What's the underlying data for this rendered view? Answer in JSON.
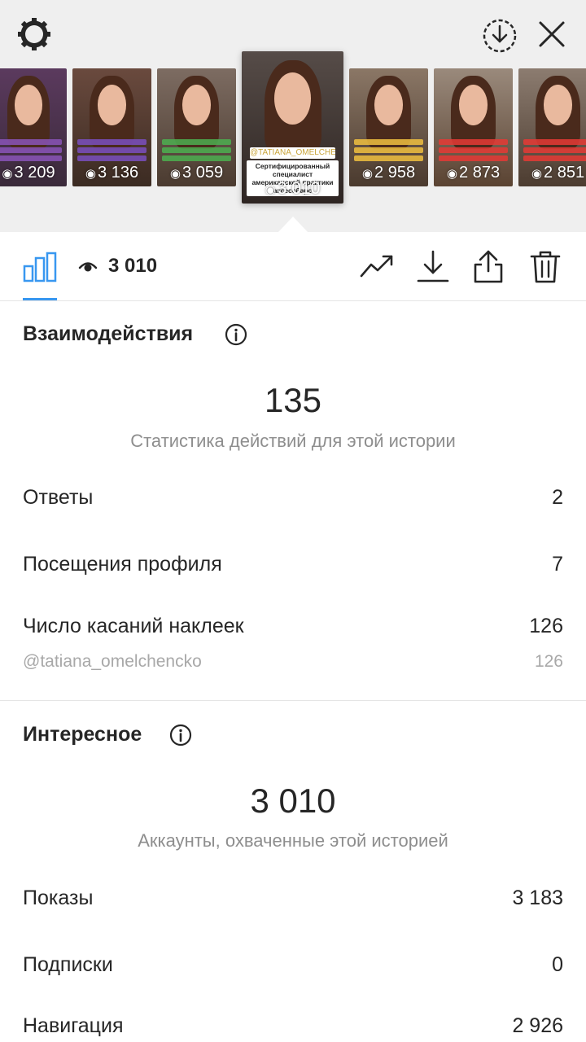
{
  "stories": [
    {
      "views": "3 209"
    },
    {
      "views": "3 136"
    },
    {
      "views": "3 059"
    },
    {
      "views": "3 010",
      "selected": true
    },
    {
      "views": "2 958"
    },
    {
      "views": "2 873"
    },
    {
      "views": "2 851"
    }
  ],
  "selected_story": {
    "tag": "@TATIANA_OMELCHENCHO",
    "caption": "Сертифицированный специалист американской практики аксессбарс"
  },
  "toolbar": {
    "reach_count": "3 010",
    "icons": [
      "bar-chart-icon",
      "eye-icon",
      "trend-icon",
      "download-icon",
      "share-icon",
      "trash-icon"
    ]
  },
  "interactions": {
    "title": "Взаимодействия",
    "total": "135",
    "subtitle": "Статистика действий для этой истории",
    "rows": [
      {
        "label": "Ответы",
        "value": "2"
      },
      {
        "label": "Посещения профиля",
        "value": "7"
      },
      {
        "label": "Число касаний наклеек",
        "value": "126"
      }
    ],
    "sticker": {
      "label": "@tatiana_omelchencko",
      "value": "126"
    }
  },
  "discovery": {
    "title": "Интересное",
    "total": "3 010",
    "subtitle": "Аккаунты, охваченные этой историей",
    "rows": [
      {
        "label": "Показы",
        "value": "3 183"
      },
      {
        "label": "Подписки",
        "value": "0"
      },
      {
        "label": "Навигация",
        "value": "2 926"
      }
    ]
  },
  "colors": {
    "accent": "#3897f0",
    "text": "#262626",
    "secondary": "#8e8e8e",
    "background_top": "#efefef"
  }
}
